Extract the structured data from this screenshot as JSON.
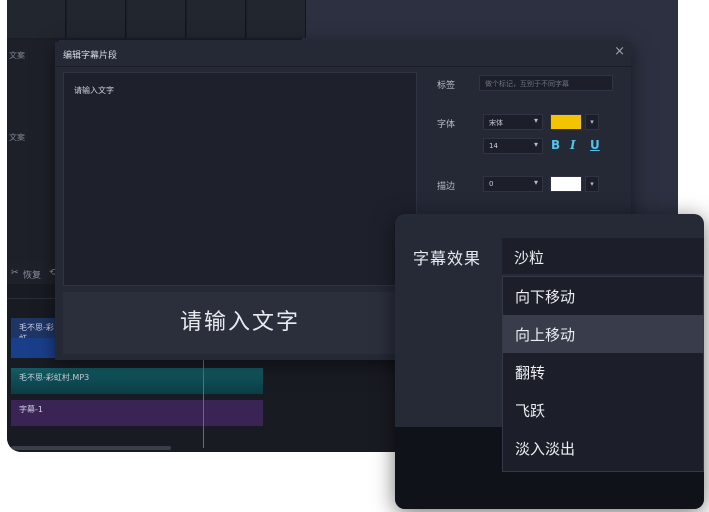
{
  "background_app": {
    "left_labels": [
      "文案",
      "文案"
    ],
    "timeline_controls": [
      "恢复"
    ],
    "tracks": [
      {
        "label": "毛不思-彩虹"
      },
      {
        "label": "毛不思-彩虹村.MP3"
      },
      {
        "label": "字幕-1"
      }
    ]
  },
  "dialog": {
    "title": "编辑字幕片段",
    "close_glyph": "×",
    "editor_text": "请输入文字",
    "preview_text": "请输入文字",
    "tag": {
      "label": "标签",
      "placeholder": "做个标记，互别于不同字幕"
    },
    "font": {
      "label": "字体",
      "family": "宋体",
      "size": "14",
      "color": "#f5c400"
    },
    "format": {
      "bold": "B",
      "italic": "I",
      "underline": "U"
    },
    "stroke": {
      "label": "描边",
      "width": "0",
      "color": "#ffffff"
    }
  },
  "effect_panel": {
    "label": "字幕效果",
    "selected": "沙粒",
    "options": [
      "向下移动",
      "向上移动",
      "翻转",
      "飞跃",
      "淡入淡出"
    ],
    "highlighted_index": 1
  },
  "colors": {
    "accent": "#4fc3e8",
    "playhead": "#e0364a"
  }
}
